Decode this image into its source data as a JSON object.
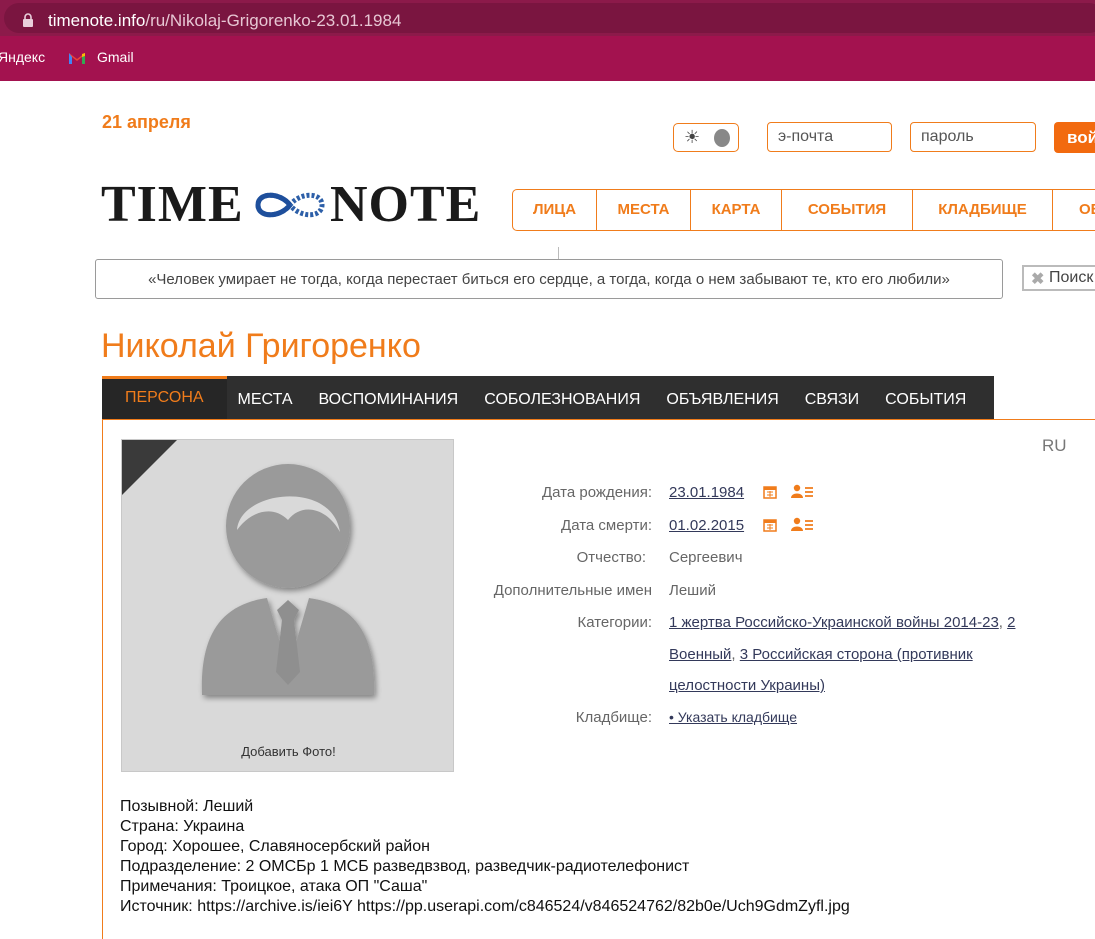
{
  "browser": {
    "url_host": "timenote.info",
    "url_path": "/ru/Nikolaj-Grigorenko-23.01.1984",
    "bookmarks": [
      {
        "label": "Яндекс"
      },
      {
        "label": "Gmail"
      }
    ]
  },
  "header": {
    "date": "21 апреля",
    "email_placeholder": "э-почта",
    "password_placeholder": "пароль",
    "login_label": "вой",
    "logo_left": "TIME",
    "logo_right": "NOTE"
  },
  "nav": {
    "items": [
      {
        "label": "ЛИЦА"
      },
      {
        "label": "МЕСТА"
      },
      {
        "label": "КАРТА"
      },
      {
        "label": "СОБЫТИЯ"
      },
      {
        "label": "КЛАДБИЩЕ"
      },
      {
        "label": "ОБ"
      }
    ]
  },
  "quote": "«Человек умирает не тогда, когда перестает биться его сердце, а тогда, когда о нем забывают те, кто его любили»",
  "search": {
    "label": "Поиск"
  },
  "person": {
    "name": "Николай Григоренко",
    "tabs": [
      {
        "label": "ПЕРСОНА",
        "active": true
      },
      {
        "label": "МЕСТА"
      },
      {
        "label": "ВОСПОМИНАНИЯ"
      },
      {
        "label": "СОБОЛЕЗНОВАНИЯ"
      },
      {
        "label": "ОБЪЯВЛЕНИЯ"
      },
      {
        "label": "СВЯЗИ"
      },
      {
        "label": "СОБЫТИЯ"
      }
    ],
    "photo_caption": "Добавить Фото!",
    "lang": "RU",
    "birth_label": "Дата рождения:",
    "birth_date": "23.01.1984",
    "death_label": "Дата смерти:",
    "death_date": "01.02.2015",
    "patronymic_label": "Отчество:",
    "patronymic": "Сергеевич",
    "extra_names_label": "Дополнительные имен",
    "extra_names": "Леший",
    "categories_label": "Категории:",
    "categories": [
      "1 жертва Российско-Украинской войны 2014-23",
      "2 Военный",
      "3 Российская сторона (противник целостности Украины)"
    ],
    "cat_line1_a": "1 жертва Российско-Украинской войны 2014-23",
    "cat_sep": ", ",
    "cat_line1_b": "2",
    "cat_line2_a": "Военный",
    "cat_line2_b": "3 Российская сторона (противник",
    "cat_line3": "целостности Украины)",
    "cemetery_label": "Кладбище:",
    "cemetery_link": "• Указать кладбище"
  },
  "notes": [
    "Позывной: Леший",
    "Страна: Украина",
    "Город: Хорошее, Славяносербский район",
    "Подразделение: 2 ОМСБр 1 МСБ разведвзвод, разведчик-радиотелефонист",
    "Примечания: Троицкое, атака ОП \"Саша\"",
    "Источник: https://archive.is/iei6Y https://pp.userapi.com/c846524/v846524762/82b0e/Uch9GdmZyfl.jpg"
  ],
  "colors": {
    "accent": "#f07c1b",
    "browser_bar": "#8c1a4a",
    "bookmark_bar": "#a3124f",
    "tab_bar": "#2f2f2f",
    "link": "#33395a"
  }
}
